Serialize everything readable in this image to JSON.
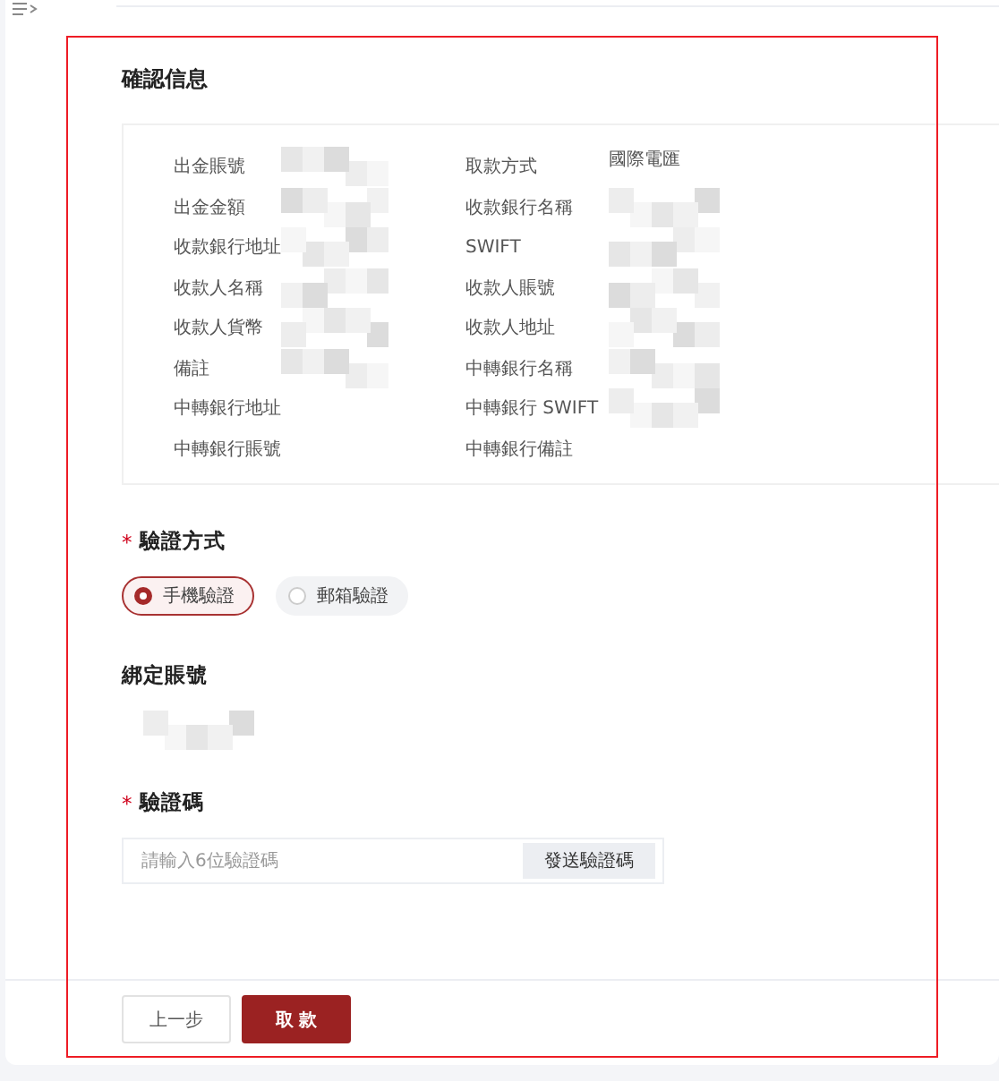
{
  "section_title": "確認信息",
  "info": {
    "fields": [
      {
        "label": "出金賬號",
        "redacted": true
      },
      {
        "label": "取款方式",
        "value": "國際電匯"
      },
      {
        "label": "出金金額",
        "redacted": true
      },
      {
        "label": "收款銀行名稱",
        "redacted": true
      },
      {
        "label": "收款銀行地址",
        "redacted": true
      },
      {
        "label": "SWIFT",
        "redacted": true
      },
      {
        "label": "收款人名稱",
        "redacted": true
      },
      {
        "label": "收款人賬號",
        "redacted": true
      },
      {
        "label": "收款人貨幣",
        "redacted": true
      },
      {
        "label": "收款人地址",
        "redacted": true
      },
      {
        "label": "備註",
        "redacted": true
      },
      {
        "label": "中轉銀行名稱",
        "redacted": true
      },
      {
        "label": "中轉銀行地址"
      },
      {
        "label": "中轉銀行 SWIFT",
        "redacted": true
      },
      {
        "label": "中轉銀行賬號"
      },
      {
        "label": "中轉銀行備註"
      }
    ]
  },
  "verify_method": {
    "label": "驗證方式",
    "required_mark": "*",
    "options": [
      {
        "label": "手機驗證",
        "selected": true
      },
      {
        "label": "郵箱驗證",
        "selected": false
      }
    ]
  },
  "bound_account": {
    "label": "綁定賬號",
    "redacted": true
  },
  "code": {
    "label": "驗證碼",
    "required_mark": "*",
    "placeholder": "請輸入6位驗證碼",
    "send_button": "發送驗證碼"
  },
  "buttons": [
    {
      "label": "上一步",
      "kind": "secondary"
    },
    {
      "label": "取 款",
      "kind": "primary"
    }
  ]
}
